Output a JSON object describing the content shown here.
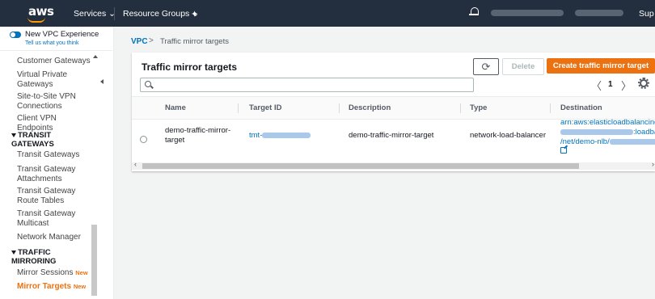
{
  "topnav": {
    "logo": "aws",
    "services": "Services ⌄",
    "resource_groups": "Resource Groups ⌄",
    "support": "Sup"
  },
  "sidebar": {
    "vpc_experience": "New VPC Experience",
    "tell_us": "Tell us what you think",
    "items": [
      "Customer Gateways",
      "Virtual Private Gateways",
      "Site-to-Site VPN Connections",
      "Client VPN Endpoints",
      "Transit Gateways",
      "Transit Gateway Attachments",
      "Transit Gateway Route Tables",
      "Transit Gateway Multicast",
      "Network Manager",
      "Mirror Sessions",
      "Mirror Targets"
    ],
    "section_transit": "TRANSIT GATEWAYS",
    "section_mirroring": "TRAFFIC MIRRORING",
    "new_badge": "New"
  },
  "breadcrumb": {
    "root": "VPC",
    "separator": ">",
    "current": "Traffic mirror targets"
  },
  "panel": {
    "title": "Traffic mirror targets",
    "refresh_icon": "refresh-icon",
    "delete_label": "Delete",
    "create_label": "Create traffic mirror target",
    "search_placeholder": "",
    "page_prev": "〈",
    "page_number": "1",
    "page_next": "〉"
  },
  "table": {
    "columns": [
      "Name",
      "Target ID",
      "Description",
      "Type",
      "Destination"
    ],
    "rows": [
      {
        "name": "demo-traffic-mirror-target",
        "target_id_prefix": "tmt-",
        "description": "demo-traffic-mirror-target",
        "type": "network-load-balancer",
        "destination_line1": "arn:aws:elasticloadbalancing:",
        "destination_line2": ":loadbalan",
        "destination_line3": "/net/demo-nlb/"
      }
    ]
  },
  "colors": {
    "nav_bg": "#232f3e",
    "accent_orange": "#ec7211",
    "link_blue": "#0073bb"
  }
}
